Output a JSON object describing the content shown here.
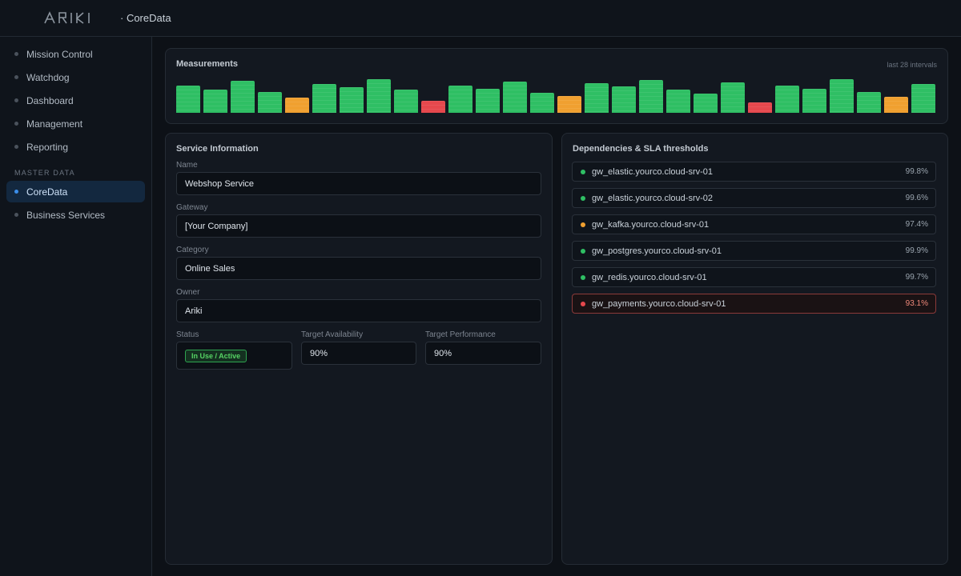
{
  "header": {
    "logo_text": "ARIKI",
    "breadcrumb": "· CoreData"
  },
  "sidebar": {
    "items": [
      {
        "label": "Mission Control"
      },
      {
        "label": "Watchdog"
      },
      {
        "label": "Dashboard"
      },
      {
        "label": "Management"
      },
      {
        "label": "Reporting"
      }
    ],
    "section_label": "MASTER DATA",
    "section_items": [
      {
        "label": "CoreData",
        "active": true
      },
      {
        "label": "Business Services",
        "active": false
      }
    ]
  },
  "measurements": {
    "title": "Measurements",
    "note": "last 28 intervals",
    "colors": {
      "ok": "#2fbf64",
      "warn": "#f0a030",
      "bad": "#e5484d"
    },
    "bars": [
      {
        "value": 0.8,
        "status": "ok"
      },
      {
        "value": 0.7,
        "status": "ok"
      },
      {
        "value": 0.95,
        "status": "ok"
      },
      {
        "value": 0.62,
        "status": "ok"
      },
      {
        "value": 0.45,
        "status": "warn"
      },
      {
        "value": 0.85,
        "status": "ok"
      },
      {
        "value": 0.75,
        "status": "ok"
      },
      {
        "value": 1.0,
        "status": "ok"
      },
      {
        "value": 0.68,
        "status": "ok"
      },
      {
        "value": 0.35,
        "status": "bad"
      },
      {
        "value": 0.82,
        "status": "ok"
      },
      {
        "value": 0.72,
        "status": "ok"
      },
      {
        "value": 0.92,
        "status": "ok"
      },
      {
        "value": 0.6,
        "status": "ok"
      },
      {
        "value": 0.5,
        "status": "warn"
      },
      {
        "value": 0.88,
        "status": "ok"
      },
      {
        "value": 0.78,
        "status": "ok"
      },
      {
        "value": 0.98,
        "status": "ok"
      },
      {
        "value": 0.7,
        "status": "ok"
      },
      {
        "value": 0.58,
        "status": "ok"
      },
      {
        "value": 0.9,
        "status": "ok"
      },
      {
        "value": 0.3,
        "status": "bad"
      },
      {
        "value": 0.8,
        "status": "ok"
      },
      {
        "value": 0.72,
        "status": "ok"
      },
      {
        "value": 1.0,
        "status": "ok"
      },
      {
        "value": 0.62,
        "status": "ok"
      },
      {
        "value": 0.48,
        "status": "warn"
      },
      {
        "value": 0.85,
        "status": "ok"
      }
    ]
  },
  "service": {
    "title": "Service Information",
    "fields": [
      {
        "label": "Name",
        "value": "Webshop Service"
      },
      {
        "label": "Gateway",
        "value": "[Your Company]"
      },
      {
        "label": "Category",
        "value": "Online Sales"
      },
      {
        "label": "Owner",
        "value": "Ariki"
      }
    ],
    "status_label": "Status",
    "status_value": "In Use / Active",
    "availability_label": "Target Availability",
    "availability_value": "90%",
    "performance_label": "Target Performance",
    "performance_value": "90%"
  },
  "dependencies": {
    "title": "Dependencies & SLA thresholds",
    "status_colors": {
      "ok": "#2fbf64",
      "warn": "#f0a030",
      "bad": "#e5484d"
    },
    "items": [
      {
        "name": "gw_elastic.yourco.cloud-srv-01",
        "pct": "99.8%",
        "status": "ok"
      },
      {
        "name": "gw_elastic.yourco.cloud-srv-02",
        "pct": "99.6%",
        "status": "ok"
      },
      {
        "name": "gw_kafka.yourco.cloud-srv-01",
        "pct": "97.4%",
        "status": "warn"
      },
      {
        "name": "gw_postgres.yourco.cloud-srv-01",
        "pct": "99.9%",
        "status": "ok"
      },
      {
        "name": "gw_redis.yourco.cloud-srv-01",
        "pct": "99.7%",
        "status": "ok"
      },
      {
        "name": "gw_payments.yourco.cloud-srv-01",
        "pct": "93.1%",
        "status": "bad"
      }
    ]
  }
}
